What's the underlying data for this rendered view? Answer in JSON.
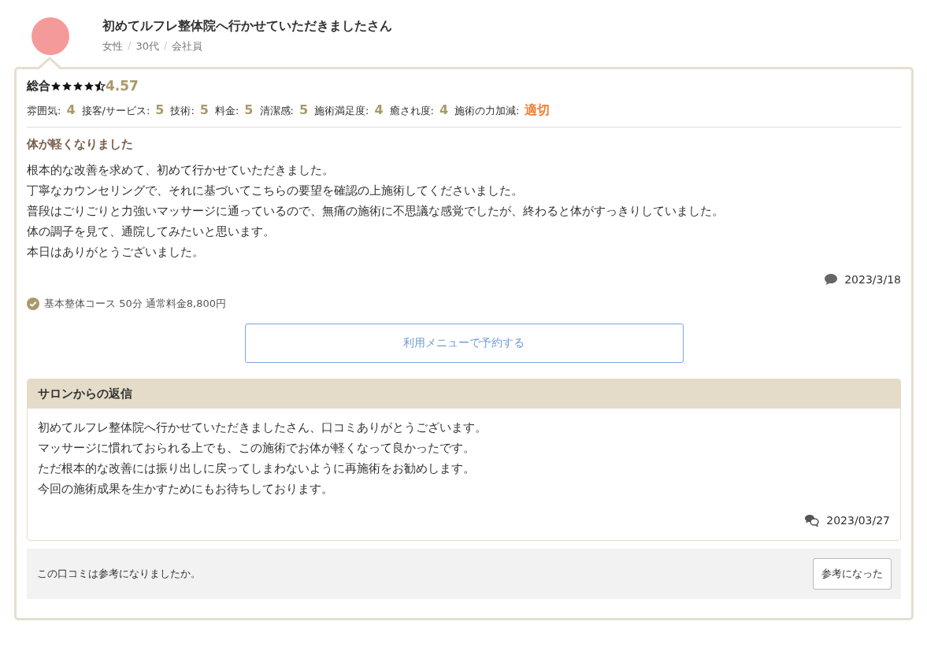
{
  "reviewer": {
    "name": "初めてルフレ整体院へ行かせていただきましたさん",
    "attributes": [
      "女性",
      "30代",
      "会社員"
    ],
    "separator": "/"
  },
  "overall": {
    "label": "総合",
    "stars": 4.5,
    "score": "4.57"
  },
  "ratings": [
    {
      "kind": "score",
      "label": "雰囲気:",
      "value": "4"
    },
    {
      "kind": "score",
      "label": "接客/サービス:",
      "value": "5"
    },
    {
      "kind": "score",
      "label": "技術:",
      "value": "5"
    },
    {
      "kind": "score",
      "label": "料金:",
      "value": "5"
    },
    {
      "kind": "score",
      "label": "清潔感:",
      "value": "5"
    },
    {
      "kind": "score",
      "label": "施術満足度:",
      "value": "4"
    },
    {
      "kind": "score",
      "label": "癒され度:",
      "value": "4"
    },
    {
      "kind": "text",
      "label": "施術の力加減:",
      "value": "適切"
    }
  ],
  "review": {
    "title": "体が軽くなりました",
    "body": [
      "根本的な改善を求めて、初めて行かせていただきました。",
      "丁寧なカウンセリングで、それに基づいてこちらの要望を確認の上施術してくださいました。",
      "普段はごりごりと力強いマッサージに通っているので、無痛の施術に不思議な感覚でしたが、終わると体がすっきりしていました。",
      "体の調子を見て、通院してみたいと思います。",
      "本日はありがとうございました。"
    ],
    "date": "2023/3/18"
  },
  "menu": {
    "text": "基本整体コース 50分 通常料金8,800円",
    "button": "利用メニューで予約する"
  },
  "reply": {
    "title": "サロンからの返信",
    "body": [
      "初めてルフレ整体院へ行かせていただきましたさん、口コミありがとうございます。",
      "マッサージに慣れておられる上でも、この施術でお体が軽くなって良かったです。",
      "ただ根本的な改善には振り出しに戻ってしまわないように再施術をお勧めします。",
      "今回の施術成果を生かすためにもお待ちしております。"
    ],
    "date": "2023/03/27"
  },
  "helpful": {
    "question": "この口コミは参考になりましたか。",
    "button": "参考になった"
  }
}
